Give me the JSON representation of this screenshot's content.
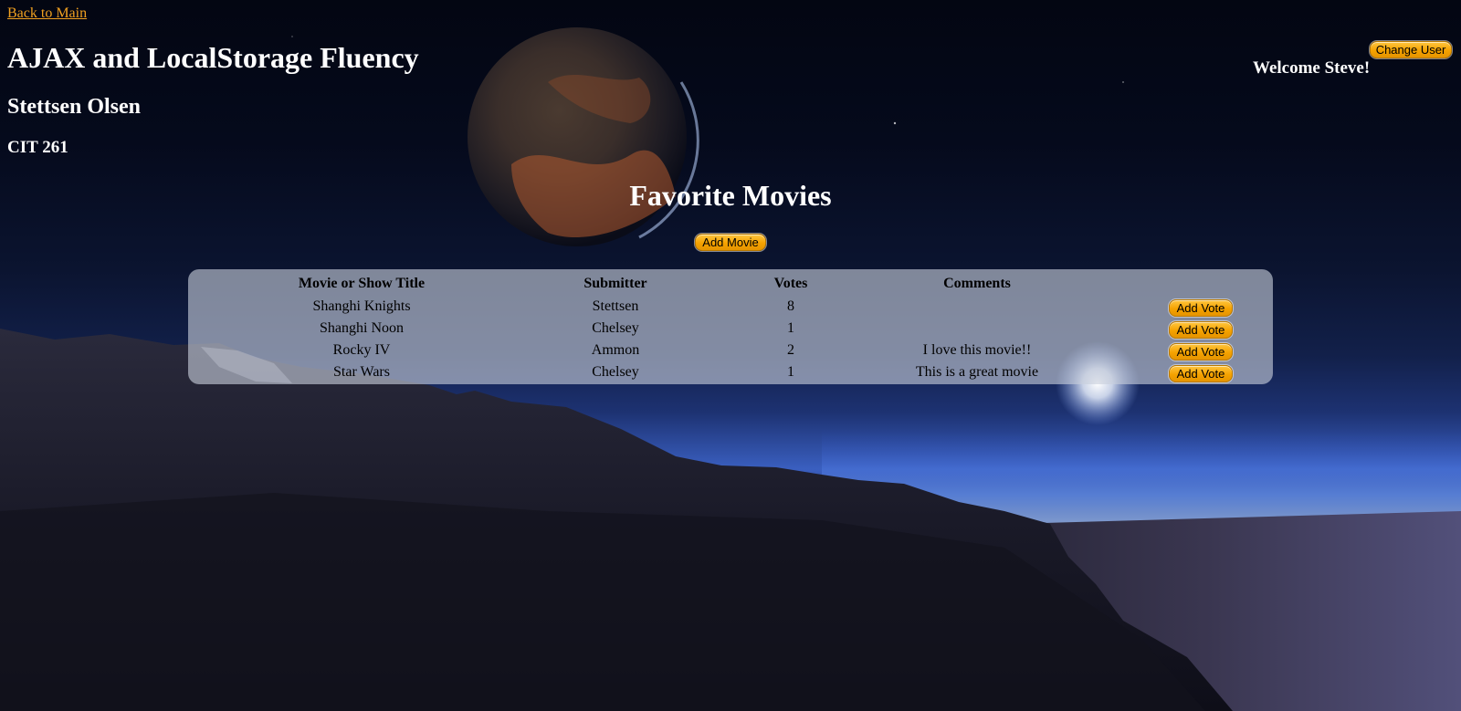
{
  "nav": {
    "back_link": "Back to Main"
  },
  "header": {
    "title": "AJAX and LocalStorage Fluency",
    "author": "Stettsen Olsen",
    "course": "CIT 261"
  },
  "user": {
    "change_user_label": "Change User",
    "welcome": "Welcome Steve!"
  },
  "movies_section": {
    "title": "Favorite Movies",
    "add_movie_label": "Add Movie",
    "columns": [
      "Movie or Show Title",
      "Submitter",
      "Votes",
      "Comments"
    ],
    "add_vote_label": "Add Vote",
    "rows": [
      {
        "title": "Shanghi Knights",
        "submitter": "Stettsen",
        "votes": "8",
        "comment": ""
      },
      {
        "title": "Shanghi Noon",
        "submitter": "Chelsey",
        "votes": "1",
        "comment": ""
      },
      {
        "title": "Rocky IV",
        "submitter": "Ammon",
        "votes": "2",
        "comment": "I love this movie!!"
      },
      {
        "title": "Star Wars",
        "submitter": "Chelsey",
        "votes": "1",
        "comment": "This is a great movie"
      }
    ]
  },
  "colors": {
    "link": "#f0a020",
    "button": "#f5a200",
    "heading_text": "#ffffff",
    "table_panel": "rgba(200,206,220,0.62)"
  }
}
